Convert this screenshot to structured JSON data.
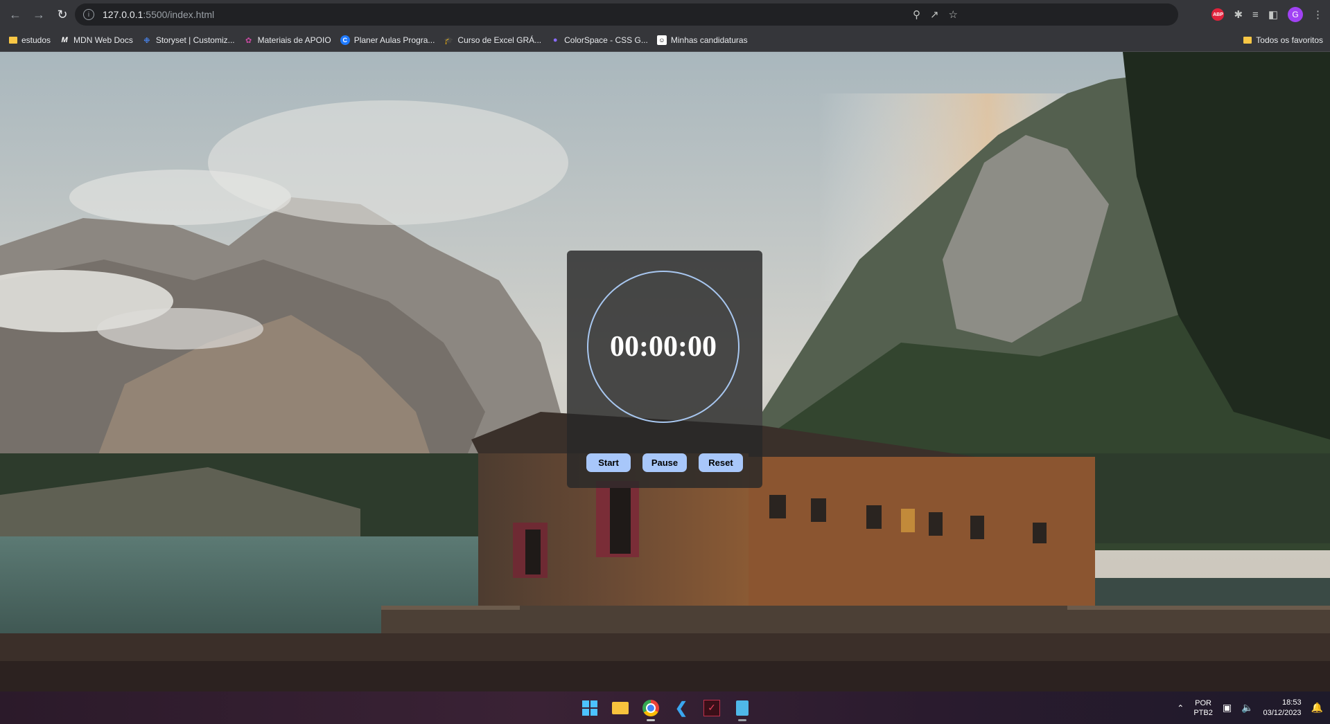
{
  "browser": {
    "url_host": "127.0.0.1",
    "url_rest": ":5500/index.html",
    "profile_initial": "G",
    "abp_label": "ABP"
  },
  "bookmarks": [
    {
      "label": "estudos",
      "icon": "folder-icon"
    },
    {
      "label": "MDN Web Docs",
      "icon": "mdn-icon"
    },
    {
      "label": "Storyset | Customiz...",
      "icon": "storyset-icon"
    },
    {
      "label": "Materiais de APOIO",
      "icon": "apoio-icon"
    },
    {
      "label": "Planer Aulas Progra...",
      "icon": "canva-icon"
    },
    {
      "label": "Curso de Excel GRÁ...",
      "icon": "course-icon"
    },
    {
      "label": "ColorSpace - CSS G...",
      "icon": "colorspace-icon"
    },
    {
      "label": "Minhas candidaturas",
      "icon": "github-icon"
    }
  ],
  "bookmarks_right": "Todos os favoritos",
  "stopwatch": {
    "time": "00:00:00",
    "start_label": "Start",
    "pause_label": "Pause",
    "reset_label": "Reset"
  },
  "taskbar": {
    "lang_top": "POR",
    "lang_bottom": "PTB2",
    "time": "18:53",
    "date": "03/12/2023"
  },
  "colors": {
    "accent": "#a8c7fa",
    "ring": "#a8c7f0"
  }
}
